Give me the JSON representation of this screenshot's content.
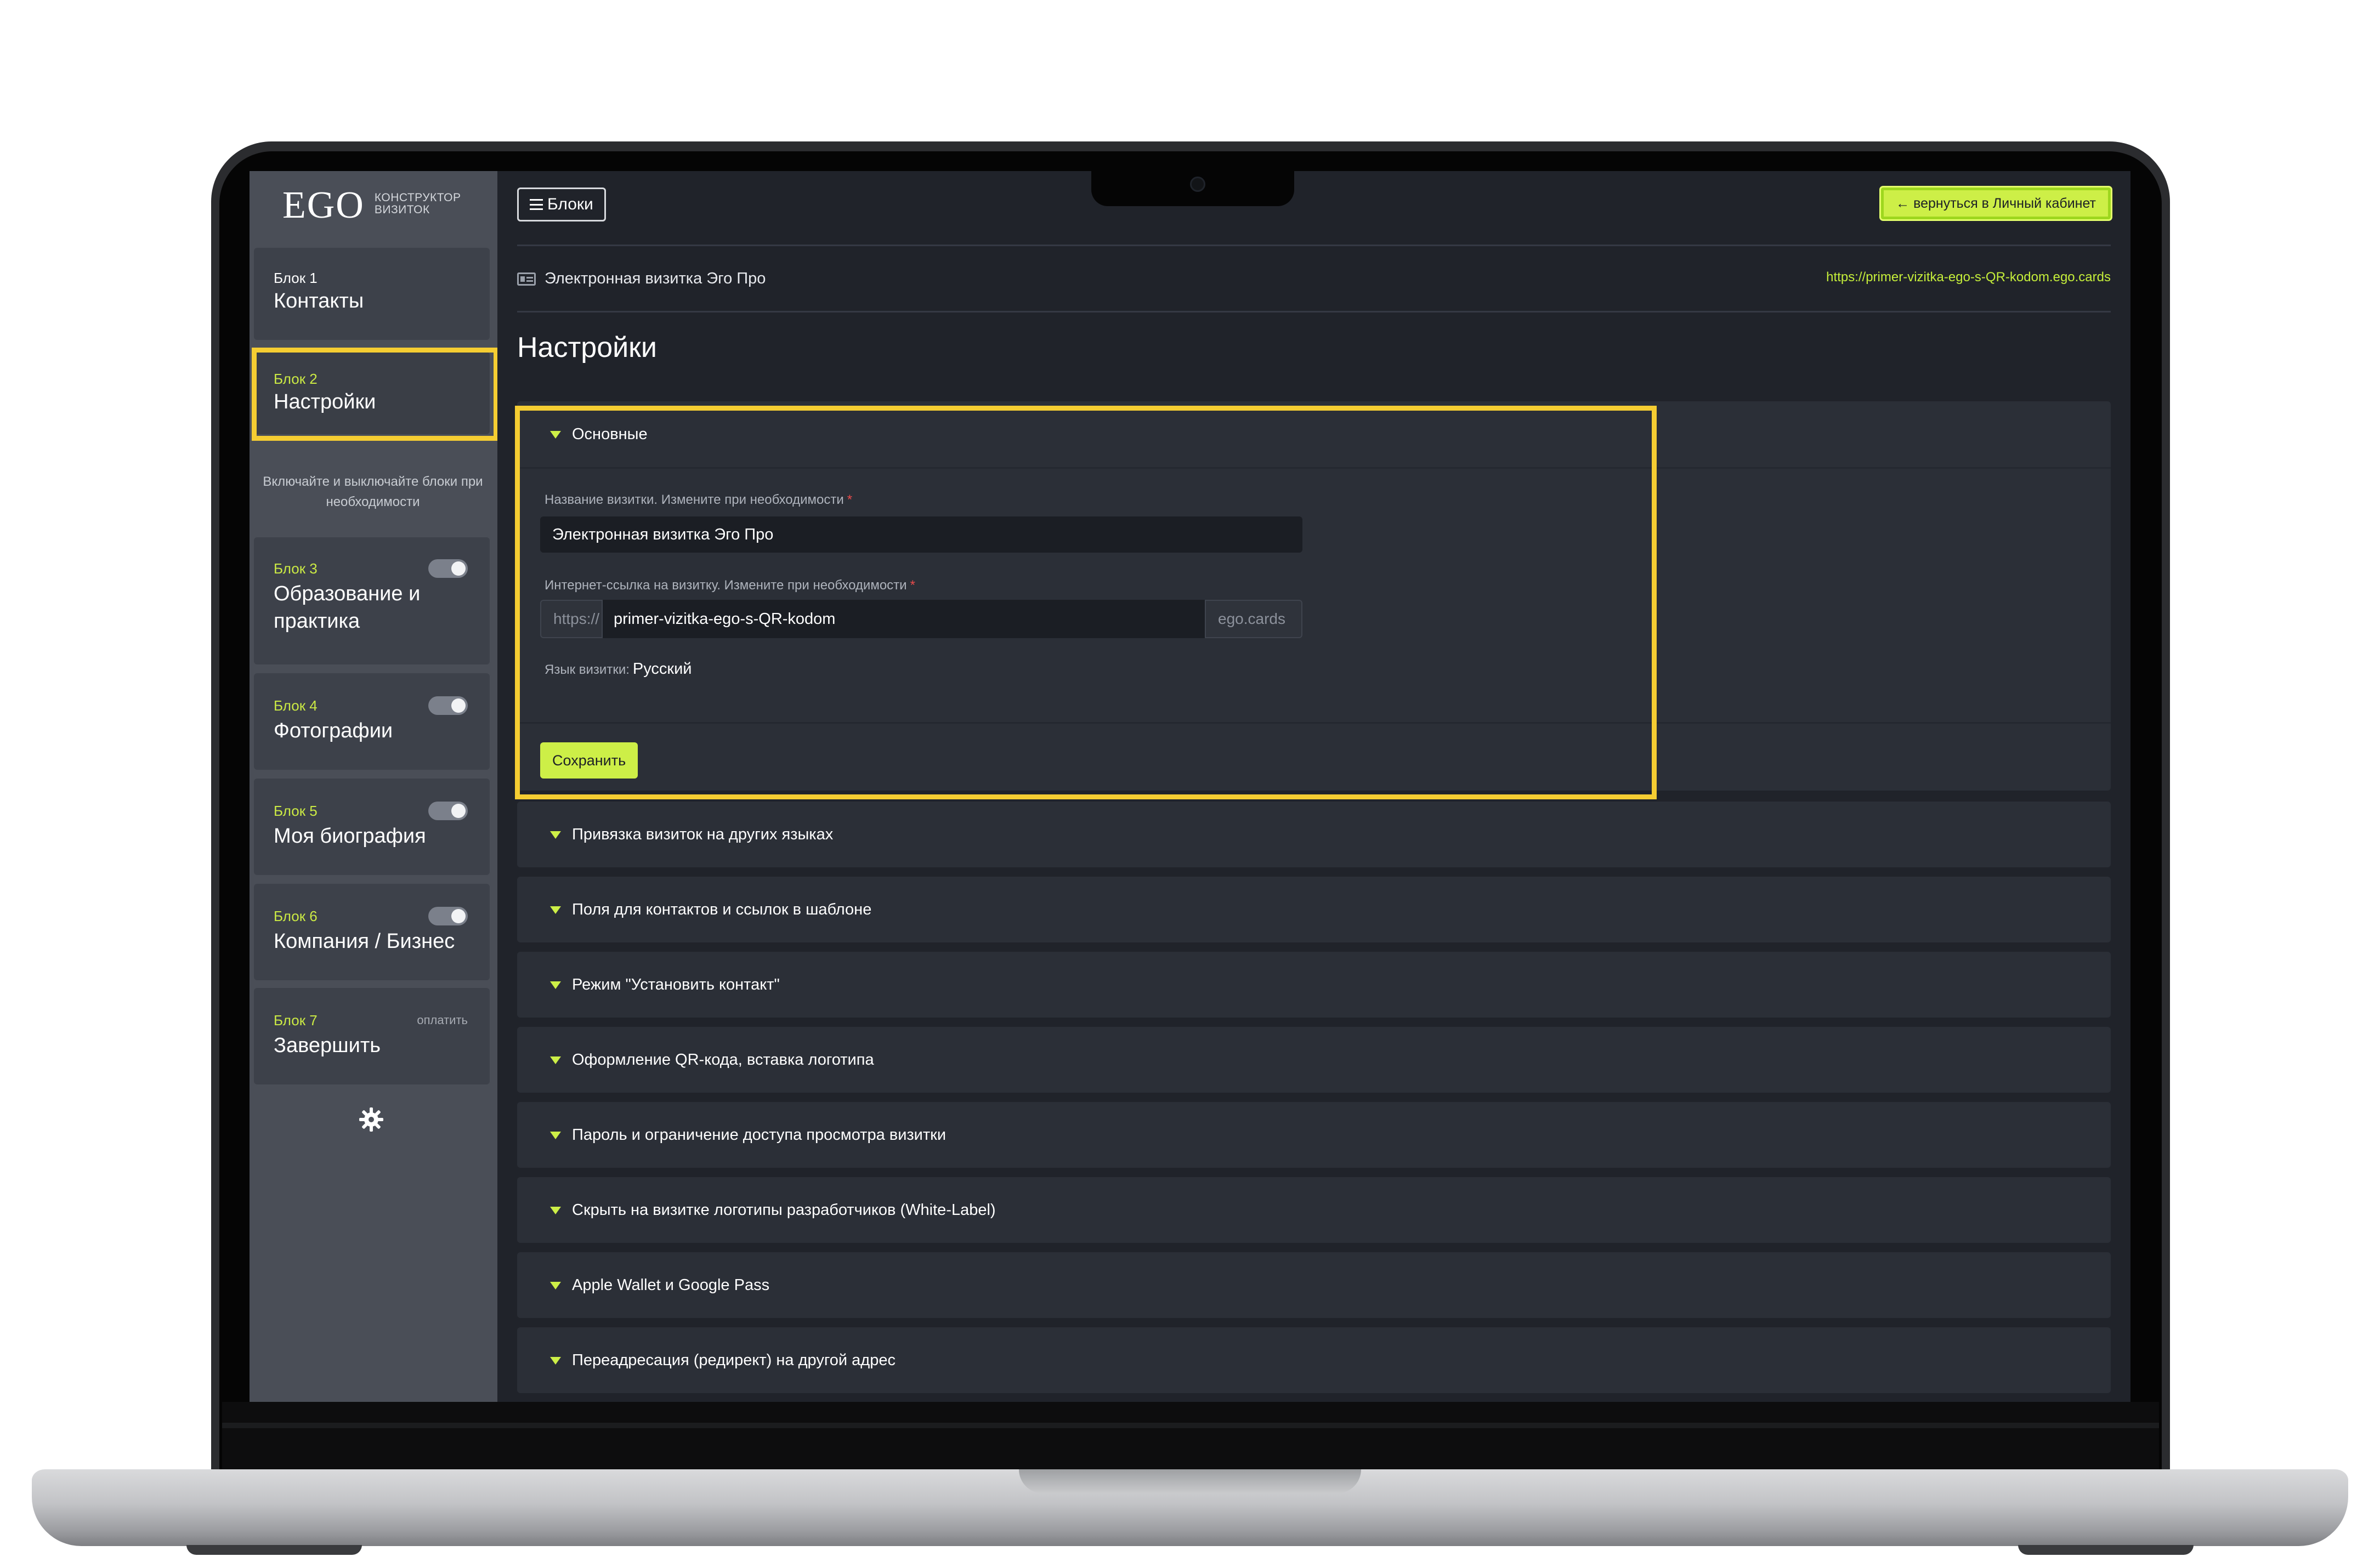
{
  "sidebar": {
    "logo": {
      "main": "EGO",
      "sub_line1": "КОНСТРУКТОР",
      "sub_line2": "ВИЗИТОК"
    },
    "blocks": [
      {
        "num": "Блок 1",
        "title": "Контакты",
        "active": false
      },
      {
        "num": "Блок 2",
        "title": "Настройки",
        "active": true
      },
      {
        "num": "Блок 3",
        "title": "Образование и практика",
        "toggle": true
      },
      {
        "num": "Блок 4",
        "title": "Фотографии",
        "toggle": true
      },
      {
        "num": "Блок 5",
        "title": "Моя биография",
        "toggle": true
      },
      {
        "num": "Блок 6",
        "title": "Компания / Бизнес",
        "toggle": true
      },
      {
        "num": "Блок 7",
        "title": "Завершить",
        "badge": "оплатить"
      }
    ],
    "hint": "Включайте и выключайте блоки при необходимости",
    "settings_icon": "gear-icon"
  },
  "topbar": {
    "blocks_button": "Блоки",
    "back_button": "← вернуться в Личный кабинет"
  },
  "card": {
    "title": "Электронная визитка Эго Про",
    "url": "https://primer-vizitka-ego-s-QR-kodom.ego.cards"
  },
  "page_title": "Настройки",
  "basic_panel": {
    "label": "Основные",
    "name_label": "Название визитки. Измените при необходимости",
    "name_value": "Электронная визитка Эго Про",
    "link_label": "Интернет-ссылка на визитку. Измените при необходимости",
    "link_prefix": "https://",
    "link_value": "primer-vizitka-ego-s-QR-kodom",
    "link_suffix": "ego.cards",
    "lang_label": "Язык визитки:",
    "lang_value": "Русский",
    "save_button": "Сохранить",
    "required_mark": "*"
  },
  "accordions": [
    "Привязка визиток на других языках",
    "Поля для контактов и ссылок в шаблоне",
    "Режим \"Установить контакт\"",
    "Оформление QR-кода, вставка логотипа",
    "Пароль и ограничение доступа просмотра визитки",
    "Скрыть на визитке логотипы разработчиков (White-Label)",
    "Apple Wallet и Google Pass",
    "Переадресация (редирект) на другой адрес"
  ],
  "colors": {
    "accent": "#cdef47",
    "highlight": "#f5cd32",
    "sidebar": "#4a4e57",
    "main": "#20232a"
  }
}
